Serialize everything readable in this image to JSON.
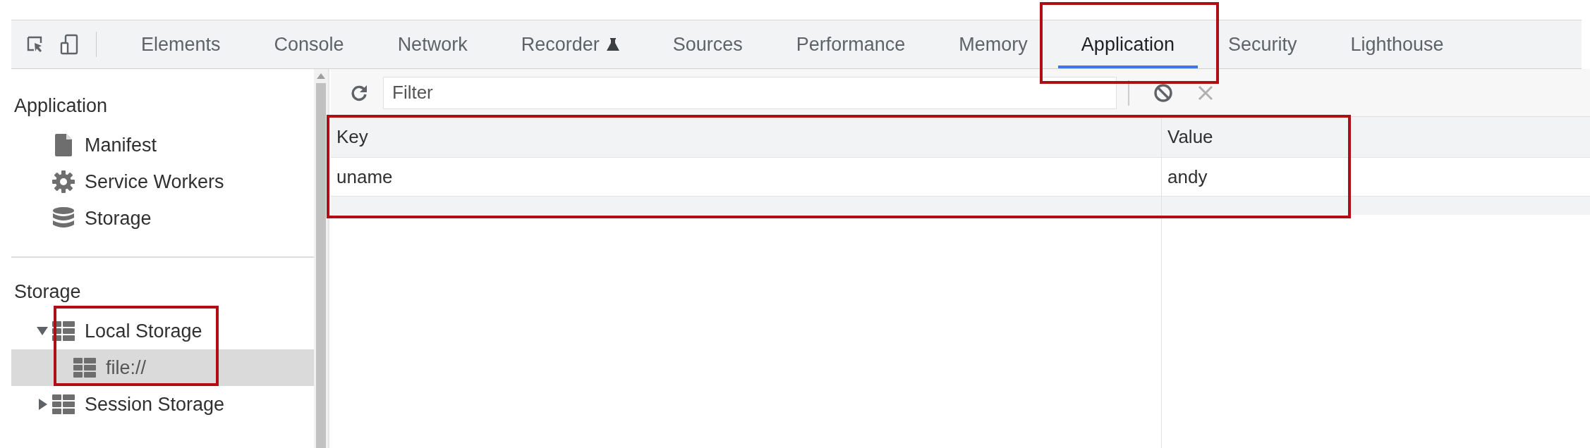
{
  "tabs": [
    {
      "label": "Elements",
      "selected": false,
      "highlighted": false
    },
    {
      "label": "Console",
      "selected": false,
      "highlighted": false
    },
    {
      "label": "Network",
      "selected": false,
      "highlighted": false
    },
    {
      "label": "Recorder",
      "selected": false,
      "highlighted": false,
      "experimental": true
    },
    {
      "label": "Sources",
      "selected": false,
      "highlighted": false
    },
    {
      "label": "Performance",
      "selected": false,
      "highlighted": false
    },
    {
      "label": "Memory",
      "selected": false,
      "highlighted": false
    },
    {
      "label": "Application",
      "selected": true,
      "highlighted": true
    },
    {
      "label": "Security",
      "selected": false,
      "highlighted": false
    },
    {
      "label": "Lighthouse",
      "selected": false,
      "highlighted": false
    }
  ],
  "sidebar": {
    "sections": [
      {
        "title": "Application",
        "items": [
          {
            "label": "Manifest",
            "kind": "file",
            "selected": false
          },
          {
            "label": "Service Workers",
            "kind": "gear",
            "selected": false
          },
          {
            "label": "Storage",
            "kind": "database",
            "selected": false
          }
        ]
      },
      {
        "title": "Storage",
        "items": [
          {
            "label": "Local Storage",
            "kind": "grid",
            "selected": false,
            "expanded": true,
            "highlighted": true,
            "children": [
              {
                "label": "file://",
                "kind": "grid",
                "selected": true
              }
            ]
          },
          {
            "label": "Session Storage",
            "kind": "grid",
            "selected": false,
            "expanded": false,
            "highlighted": false
          }
        ]
      }
    ]
  },
  "filter": {
    "placeholder": "Filter"
  },
  "table": {
    "highlighted": true,
    "columns": [
      "Key",
      "Value"
    ],
    "rows": [
      [
        "uname",
        "andy"
      ]
    ]
  }
}
